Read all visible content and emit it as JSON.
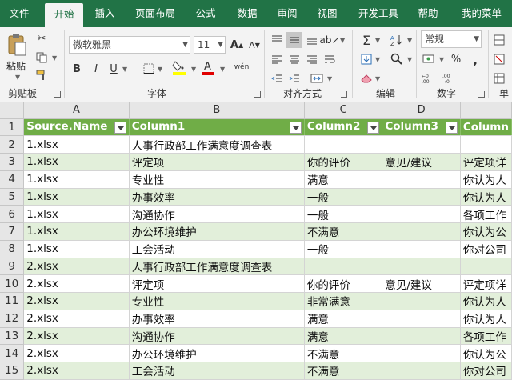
{
  "tabs": [
    "文件",
    "开始",
    "插入",
    "页面布局",
    "公式",
    "数据",
    "审阅",
    "视图",
    "开发工具",
    "帮助",
    "我的菜单"
  ],
  "active_tab": "开始",
  "ribbon": {
    "clipboard": {
      "label": "剪贴板",
      "paste_label": "粘贴"
    },
    "font": {
      "label": "字体",
      "font_name": "微软雅黑",
      "font_size": "11",
      "bold": "B",
      "italic": "I",
      "underline": "U",
      "grow": "A",
      "shrink": "A",
      "phonetic": "wén"
    },
    "alignment": {
      "label": "对齐方式"
    },
    "editing": {
      "label": "编辑"
    },
    "number": {
      "label": "数字",
      "format": "常规",
      "percent": "%",
      "comma": ","
    },
    "cells": {
      "label": "单"
    }
  },
  "columns": [
    "A",
    "B",
    "C",
    "D",
    ""
  ],
  "rows": [
    {
      "num": "1",
      "cells": [
        "Source.Name",
        "Column1",
        "Column2",
        "Column3",
        "Column"
      ]
    },
    {
      "num": "2",
      "cells": [
        "1.xlsx",
        "人事行政部工作满意度调查表",
        "",
        "",
        ""
      ]
    },
    {
      "num": "3",
      "cells": [
        "1.xlsx",
        "评定项",
        "你的评价",
        "意见/建议",
        "评定项详"
      ]
    },
    {
      "num": "4",
      "cells": [
        "1.xlsx",
        "专业性",
        "满意",
        "",
        "你认为人"
      ]
    },
    {
      "num": "5",
      "cells": [
        "1.xlsx",
        "办事效率",
        "一般",
        "",
        "你认为人"
      ]
    },
    {
      "num": "6",
      "cells": [
        "1.xlsx",
        "沟通协作",
        "一般",
        "",
        "各项工作"
      ]
    },
    {
      "num": "7",
      "cells": [
        "1.xlsx",
        "办公环境维护",
        "不满意",
        "",
        "你认为公"
      ]
    },
    {
      "num": "8",
      "cells": [
        "1.xlsx",
        "工会活动",
        "一般",
        "",
        "你对公司"
      ]
    },
    {
      "num": "9",
      "cells": [
        "2.xlsx",
        "人事行政部工作满意度调查表",
        "",
        "",
        ""
      ]
    },
    {
      "num": "10",
      "cells": [
        "2.xlsx",
        "评定项",
        "你的评价",
        "意见/建议",
        "评定项详"
      ]
    },
    {
      "num": "11",
      "cells": [
        "2.xlsx",
        "专业性",
        "非常满意",
        "",
        "你认为人"
      ]
    },
    {
      "num": "12",
      "cells": [
        "2.xlsx",
        "办事效率",
        "满意",
        "",
        "你认为人"
      ]
    },
    {
      "num": "13",
      "cells": [
        "2.xlsx",
        "沟通协作",
        "满意",
        "",
        "各项工作"
      ]
    },
    {
      "num": "14",
      "cells": [
        "2.xlsx",
        "办公环境维护",
        "不满意",
        "",
        "你认为公"
      ]
    },
    {
      "num": "15",
      "cells": [
        "2.xlsx",
        "工会活动",
        "不满意",
        "",
        "你对公司"
      ]
    }
  ],
  "colors": {
    "brand": "#217346",
    "table_header": "#70ad47",
    "band": "#e2efda"
  }
}
